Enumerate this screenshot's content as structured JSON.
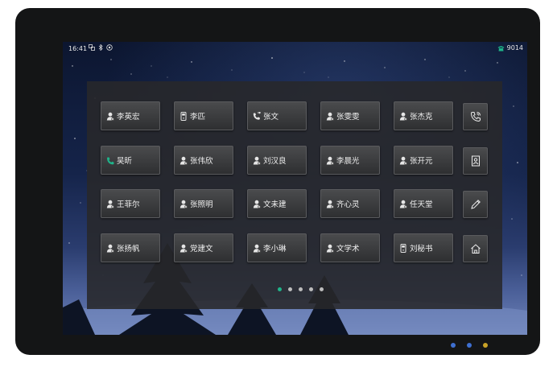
{
  "status_bar": {
    "time": "16:41",
    "extension": "9014",
    "left_icons": [
      "network-icon",
      "bluetooth-icon",
      "wifi-icon"
    ],
    "right_icon": "phone-icon",
    "phone_color": "#1fb48a"
  },
  "keys": [
    {
      "label": "李英宏",
      "icon": "contact-icon"
    },
    {
      "label": "李匹",
      "icon": "phone-device-icon"
    },
    {
      "label": "张文",
      "icon": "call-forward-icon"
    },
    {
      "label": "张雯雯",
      "icon": "contact-icon"
    },
    {
      "label": "张杰克",
      "icon": "contact-icon"
    },
    {
      "label": "吴昕",
      "icon": "phone-green-icon"
    },
    {
      "label": "张伟欣",
      "icon": "contact-icon"
    },
    {
      "label": "刘汉良",
      "icon": "contact-icon"
    },
    {
      "label": "李晨光",
      "icon": "contact-icon"
    },
    {
      "label": "张开元",
      "icon": "contact-icon"
    },
    {
      "label": "王菲尔",
      "icon": "contact-icon"
    },
    {
      "label": "张照明",
      "icon": "contact-icon"
    },
    {
      "label": "文未建",
      "icon": "contact-icon"
    },
    {
      "label": "齐心灵",
      "icon": "contact-icon"
    },
    {
      "label": "任天堂",
      "icon": "contact-icon"
    },
    {
      "label": "张扬帆",
      "icon": "contact-icon"
    },
    {
      "label": "党建文",
      "icon": "contact-icon"
    },
    {
      "label": "李小琳",
      "icon": "contact-icon"
    },
    {
      "label": "文学术",
      "icon": "contact-icon"
    },
    {
      "label": "刘秘书",
      "icon": "phone-device-icon"
    }
  ],
  "side_buttons": [
    "call-log-icon",
    "directory-icon",
    "edit-icon",
    "home-icon"
  ],
  "pagination": {
    "pages": 5,
    "active": 1
  },
  "indicator_leds": [
    "#3e6fd0",
    "#3e6fd0",
    "#c9a227"
  ]
}
